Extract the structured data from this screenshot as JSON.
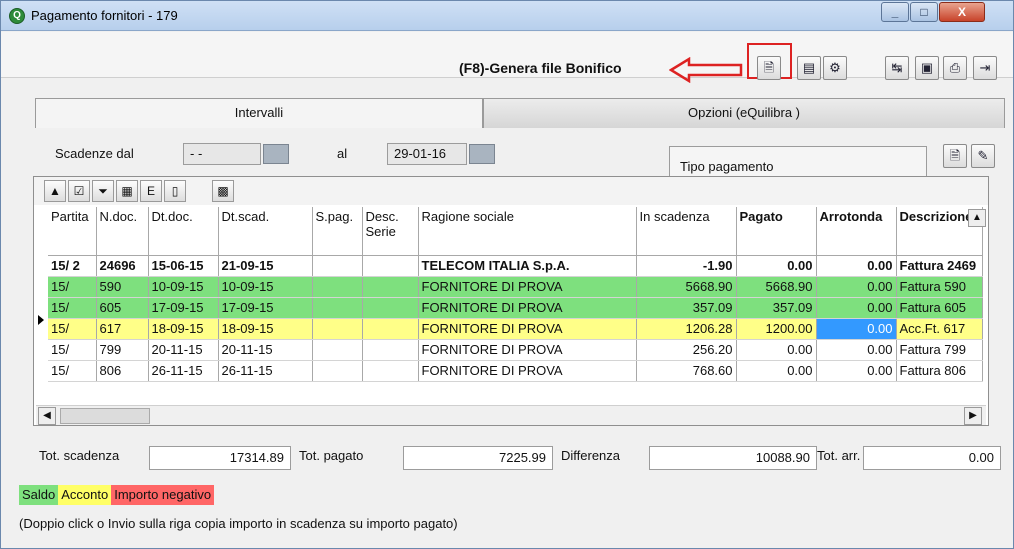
{
  "window": {
    "title": "Pagamento fornitori - 179",
    "app_icon": "Q"
  },
  "window_controls": {
    "minimize": "_",
    "maximize": "□",
    "close": "X"
  },
  "toolbar": {
    "f8_label": "(F8)-Genera file Bonifico",
    "buttons": [
      {
        "icon": "document-icon",
        "glyph": "🗎"
      },
      {
        "icon": "print-preview-icon",
        "glyph": "▤"
      },
      {
        "icon": "settings-icon",
        "glyph": "⚙"
      },
      {
        "icon": "refresh-icon",
        "glyph": "↹"
      },
      {
        "icon": "save-icon",
        "glyph": "▣"
      },
      {
        "icon": "print-icon",
        "glyph": "⎙"
      },
      {
        "icon": "exit-icon",
        "glyph": "⇥"
      }
    ],
    "accent_color": "#dd2222"
  },
  "tabs": [
    {
      "label": "Intervalli",
      "active": true
    },
    {
      "label": "Opzioni (eQuilibra )",
      "active": false
    }
  ],
  "filters": {
    "scadenze_dal_label": "Scadenze dal",
    "scadenze_dal_value": "- -",
    "al_label": "al",
    "al_value": "29-01-16",
    "tipo_pagamento_label": "Tipo pagamento"
  },
  "grid": {
    "columns": [
      {
        "label": "Partita",
        "bold": false
      },
      {
        "label": "N.doc.",
        "bold": false
      },
      {
        "label": "Dt.doc.",
        "bold": false
      },
      {
        "label": "Dt.scad.",
        "bold": false
      },
      {
        "label": "S.pag.",
        "bold": false
      },
      {
        "label": "Desc. Serie",
        "bold": false
      },
      {
        "label": "Ragione sociale",
        "bold": false
      },
      {
        "label": "In scadenza",
        "bold": false
      },
      {
        "label": "Pagato",
        "bold": true
      },
      {
        "label": "Arrotonda",
        "bold": true
      },
      {
        "label": "Descrizione",
        "bold": true
      }
    ],
    "rows": [
      {
        "style": "row-bold",
        "cells": [
          "15/ 2",
          "24696",
          "15-06-15",
          "21-09-15",
          "",
          "",
          "TELECOM ITALIA S.p.A.",
          "-1.90",
          "0.00",
          "0.00",
          "Fattura 2469"
        ]
      },
      {
        "style": "saldo",
        "cells": [
          "15/",
          "590",
          "10-09-15",
          "10-09-15",
          "",
          "",
          "FORNITORE DI PROVA",
          "5668.90",
          "5668.90",
          "0.00",
          "Fattura 590"
        ]
      },
      {
        "style": "saldo",
        "cells": [
          "15/",
          "605",
          "17-09-15",
          "17-09-15",
          "",
          "",
          "FORNITORE DI PROVA",
          "357.09",
          "357.09",
          "0.00",
          "Fattura 605"
        ]
      },
      {
        "style": "acconto",
        "cells": [
          "15/",
          "617",
          "18-09-15",
          "18-09-15",
          "",
          "",
          "FORNITORE DI PROVA",
          "1206.28",
          "1200.00",
          "0.00",
          "Acc.Ft. 617"
        ]
      },
      {
        "style": "",
        "cells": [
          "15/",
          "799",
          "20-11-15",
          "20-11-15",
          "",
          "",
          "FORNITORE DI PROVA",
          "256.20",
          "0.00",
          "0.00",
          "Fattura 799"
        ]
      },
      {
        "style": "",
        "cells": [
          "15/",
          "806",
          "26-11-15",
          "26-11-15",
          "",
          "",
          "FORNITORE DI PROVA",
          "768.60",
          "0.00",
          "0.00",
          "Fattura 806"
        ]
      }
    ]
  },
  "totals": {
    "tot_scadenza_label": "Tot. scadenza",
    "tot_scadenza_value": "17314.89",
    "tot_pagato_label": "Tot. pagato",
    "tot_pagato_value": "7225.99",
    "differenza_label": "Differenza",
    "differenza_value": "10088.90",
    "tot_arr_label": "Tot. arr.",
    "tot_arr_value": "0.00"
  },
  "legend": {
    "saldo": "Saldo",
    "acconto": "Acconto",
    "negativo": "Importo negativo"
  },
  "hint": "(Doppio click o Invio sulla riga copia importo in scadenza su importo pagato)"
}
